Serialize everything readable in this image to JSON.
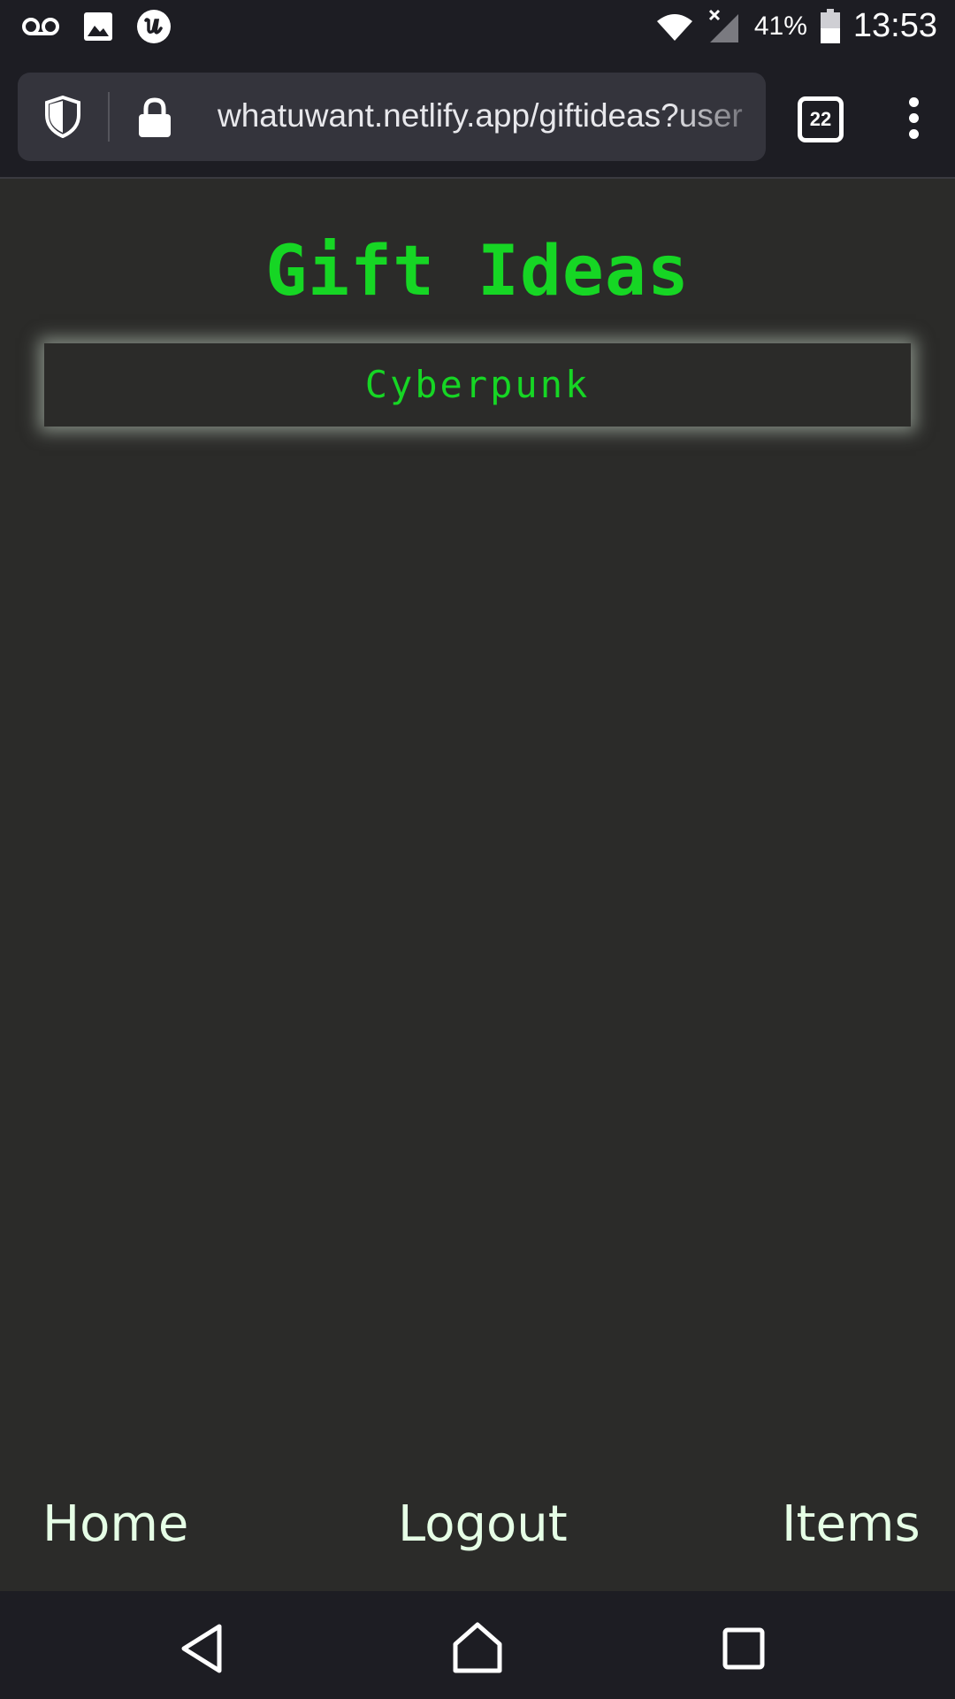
{
  "status_bar": {
    "battery_percent": "41%",
    "time": "13:53",
    "notification_icons": [
      "voicemail-icon",
      "image-icon",
      "app-u-icon"
    ],
    "system_icons": [
      "wifi-icon",
      "cell-signal-no-service-icon",
      "battery-icon"
    ]
  },
  "browser": {
    "url": "whatuwant.netlify.app/giftideas?user",
    "tab_count": "22",
    "icons": [
      "shield-icon",
      "lock-icon",
      "overflow-menu-icon"
    ]
  },
  "page": {
    "title": "Gift Ideas",
    "ideas": [
      {
        "label": "Cyberpunk"
      }
    ],
    "accent_color": "#16d624",
    "background_color": "#2b2b29"
  },
  "bottom_nav": {
    "home": "Home",
    "logout": "Logout",
    "items": "Items"
  },
  "system_nav": {
    "icons": [
      "back-icon",
      "home-icon",
      "recents-icon"
    ]
  }
}
